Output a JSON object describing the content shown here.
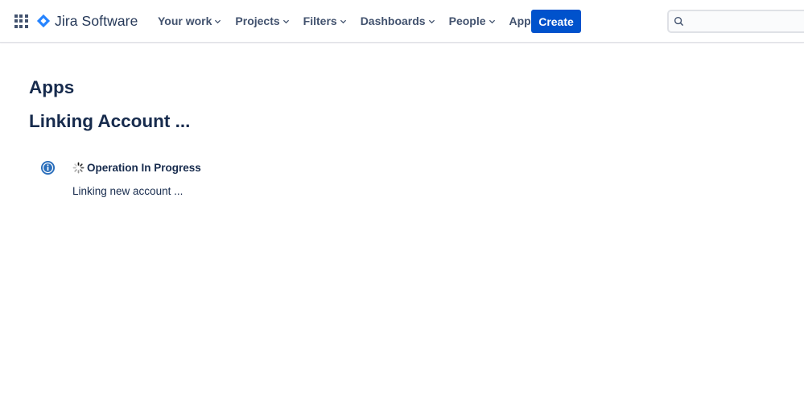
{
  "header": {
    "app_switcher_icon": "app-switcher-grid-icon",
    "logo_icon": "jira-diamond-icon",
    "logo_text": "Jira Software",
    "nav": [
      {
        "label": "Your work"
      },
      {
        "label": "Projects"
      },
      {
        "label": "Filters"
      },
      {
        "label": "Dashboards"
      },
      {
        "label": "People"
      },
      {
        "label": "Apps"
      }
    ],
    "create_label": "Create",
    "search_placeholder": ""
  },
  "main": {
    "heading": "Apps",
    "subheading": "Linking Account ...",
    "message": {
      "icon": "info-icon",
      "spinner": "loading-spinner-icon",
      "title": "Operation In Progress",
      "body": "Linking new account ..."
    }
  },
  "colors": {
    "brand_blue": "#0052cc",
    "text_dark": "#172b4d",
    "nav_text": "#42526e",
    "info_blue": "#2a6ebb"
  }
}
